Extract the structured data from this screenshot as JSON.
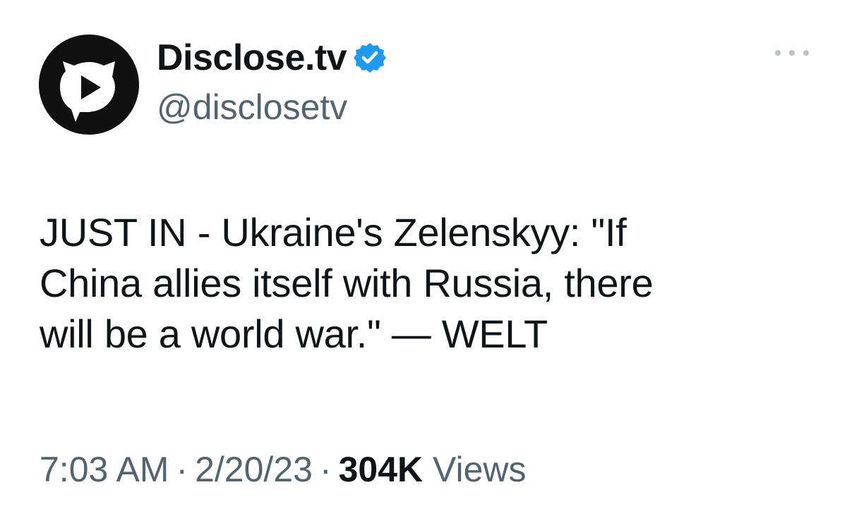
{
  "author": {
    "display_name": "Disclose.tv",
    "handle": "@disclosetv",
    "verified": true,
    "avatar_icon": "play-speech-bubble-cat-icon",
    "verified_icon": "verified-badge-icon"
  },
  "tweet": {
    "text_lines": [
      "JUST IN - Ukraine's Zelenskyy: \"If",
      "China allies itself with Russia, there",
      "will be a world war.\" — WELT"
    ]
  },
  "meta": {
    "time": "7:03 AM",
    "separator": "·",
    "date": "2/20/23",
    "views_count": "304K",
    "views_label": "Views"
  },
  "menu": {
    "icon": "more-options-icon"
  },
  "colors": {
    "text_primary": "#0f1419",
    "text_secondary": "#536471",
    "verified_blue": "#1d9bf0",
    "more_dots": "#b9c0c7",
    "avatar_bg": "#111111"
  }
}
